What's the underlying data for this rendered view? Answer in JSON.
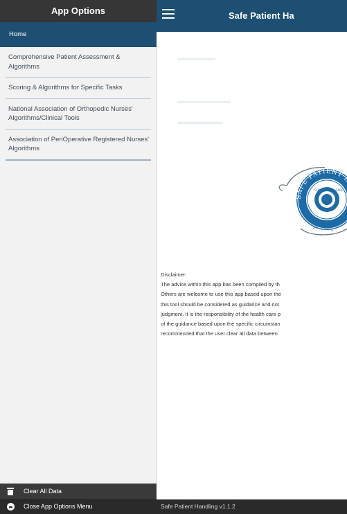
{
  "main": {
    "title": "Safe Patient Ha",
    "disclaimer_lines": [
      "Disclaimer:",
      "The advice within this app has been compiled by th",
      "Others are welcome to use this app based upon the",
      "this tool should be considered as guidance and not",
      "judgment. It is the responsibility of the health care p",
      "of the guidance based upon the specific circumstan",
      "recommended that the user clear all data between"
    ],
    "logo_text": "SAFE PATIENT HA",
    "version": "Safe Patient Handling v1.1.2"
  },
  "sidebar": {
    "title": "App Options",
    "items": [
      {
        "label": "Home",
        "active": true
      },
      {
        "label": "Comprehensive Patient Assessment & Algorithms"
      },
      {
        "label": "Scoring & Algorithms for Specific Tasks"
      },
      {
        "label": "National Association of Orthopedic Nurses' Algorithms/Clinical Tools"
      },
      {
        "label": "Association of PeriOperative Registered Nurses' Algorithms"
      }
    ],
    "clear_label": "Clear All Data",
    "close_label": "Close App Options Menu"
  },
  "colors": {
    "nav_blue": "#1d4f73",
    "sidebar_header": "#363636",
    "footer": "#2a2a2a",
    "sidebar_bg": "#f2f2f2"
  },
  "icons": [
    "menu-icon",
    "trash-icon",
    "close-circle-icon"
  ]
}
